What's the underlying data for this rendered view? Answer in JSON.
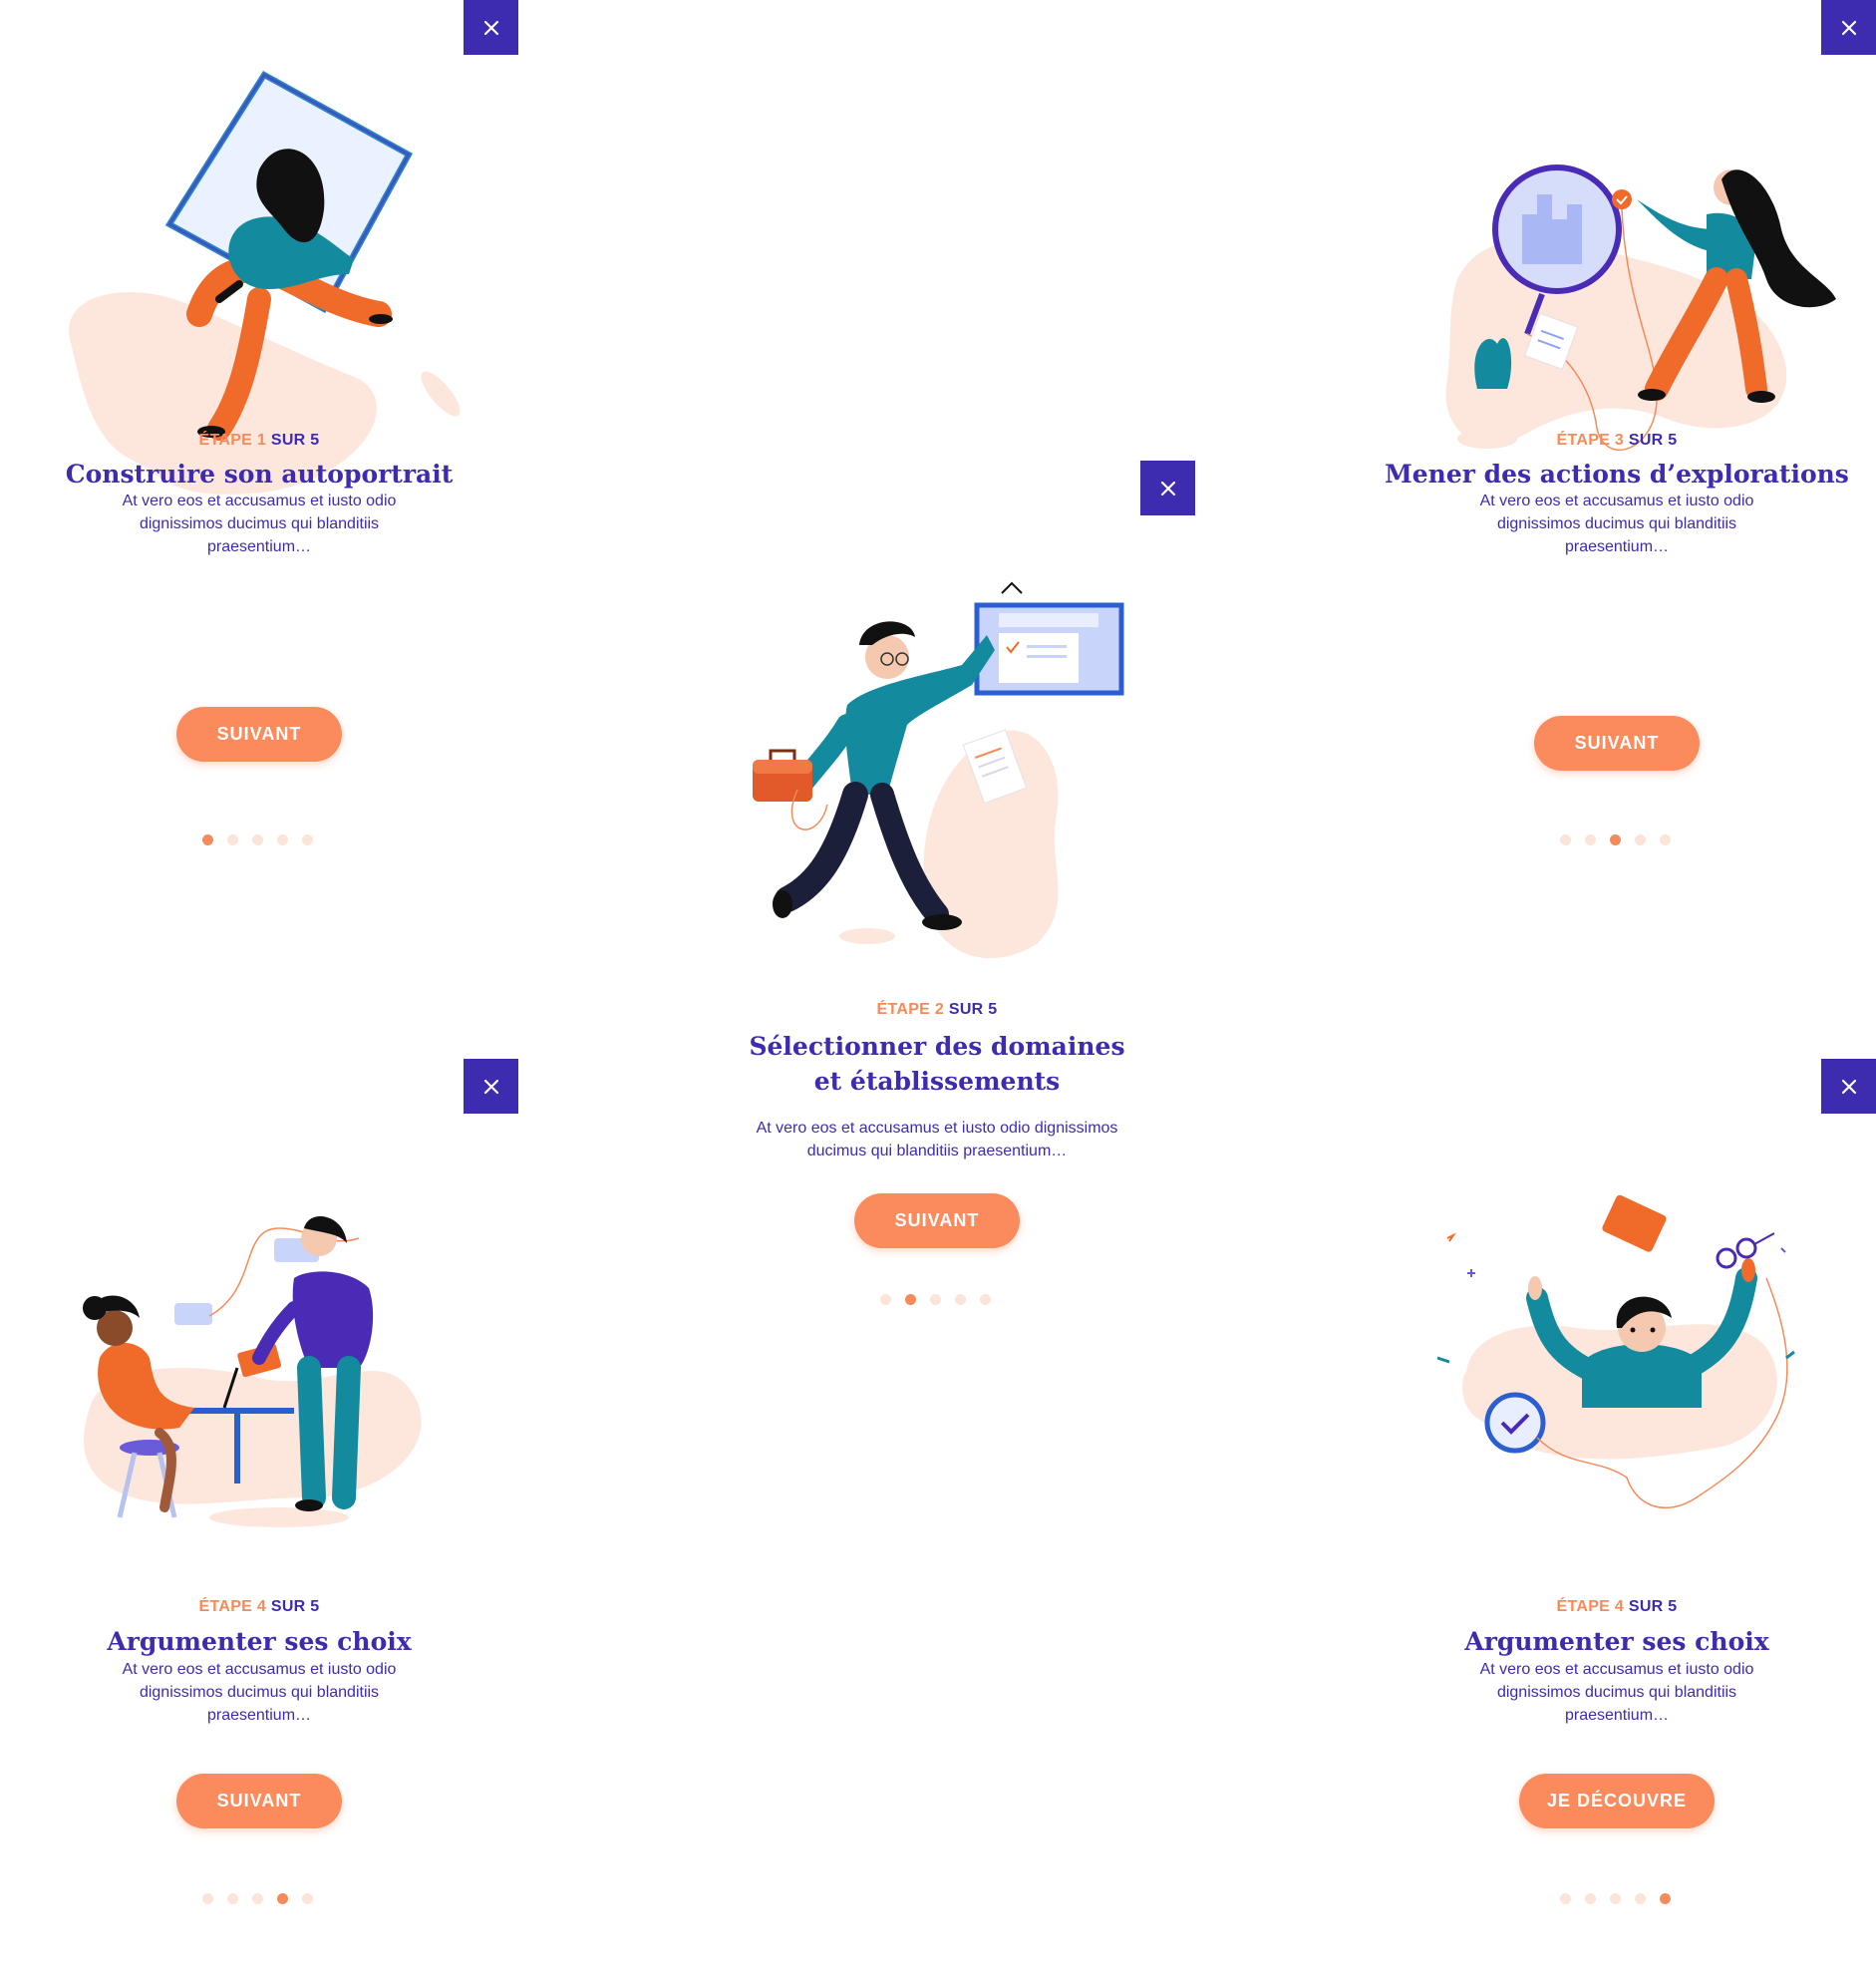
{
  "colors": {
    "primary": "#3d2bb0",
    "accent": "#fb8b5c",
    "blob": "#fde7dd",
    "teal": "#138a9e"
  },
  "cards": [
    {
      "step_prefix": "ÉTAPE",
      "step_num": "1",
      "step_suffix": "SUR 5",
      "title_line1": "Construire son autoportrait",
      "title_line2": "",
      "desc_line1": "At vero eos et accusamus et iusto odio",
      "desc_line2": "dignissimos ducimus qui blanditiis",
      "desc_line3": "praesentium…",
      "button": "SUIVANT",
      "active_dot": 1,
      "close_icon": "close-icon"
    },
    {
      "step_prefix": "ÉTAPE",
      "step_num": "2",
      "step_suffix": "SUR 5",
      "title_line1": "Sélectionner des domaines",
      "title_line2": "et établissements",
      "desc_line1": "At vero eos et accusamus et iusto odio dignissimos",
      "desc_line2": "ducimus qui blanditiis praesentium…",
      "desc_line3": "",
      "button": "SUIVANT",
      "active_dot": 2,
      "close_icon": "close-icon"
    },
    {
      "step_prefix": "ÉTAPE",
      "step_num": "3",
      "step_suffix": "SUR 5",
      "title_line1": "Mener des actions d’explorations",
      "title_line2": "",
      "desc_line1": "At vero eos et accusamus et iusto odio",
      "desc_line2": "dignissimos ducimus qui blanditiis",
      "desc_line3": "praesentium…",
      "button": "SUIVANT",
      "active_dot": 3,
      "close_icon": "close-icon"
    },
    {
      "step_prefix": "ÉTAPE",
      "step_num": "4",
      "step_suffix": "SUR 5",
      "title_line1": "Argumenter ses choix",
      "title_line2": "",
      "desc_line1": "At vero eos et accusamus et iusto odio",
      "desc_line2": "dignissimos ducimus qui blanditiis",
      "desc_line3": "praesentium…",
      "button": "SUIVANT",
      "active_dot": 4,
      "close_icon": "close-icon"
    },
    {
      "step_prefix": "ÉTAPE",
      "step_num": "4",
      "step_suffix": "SUR 5",
      "title_line1": "Argumenter ses choix",
      "title_line2": "",
      "desc_line1": "At vero eos et accusamus et iusto odio",
      "desc_line2": "dignissimos ducimus qui blanditiis",
      "desc_line3": "praesentium…",
      "button": "JE DÉCOUVRE",
      "active_dot": 5,
      "close_icon": "close-icon"
    }
  ]
}
